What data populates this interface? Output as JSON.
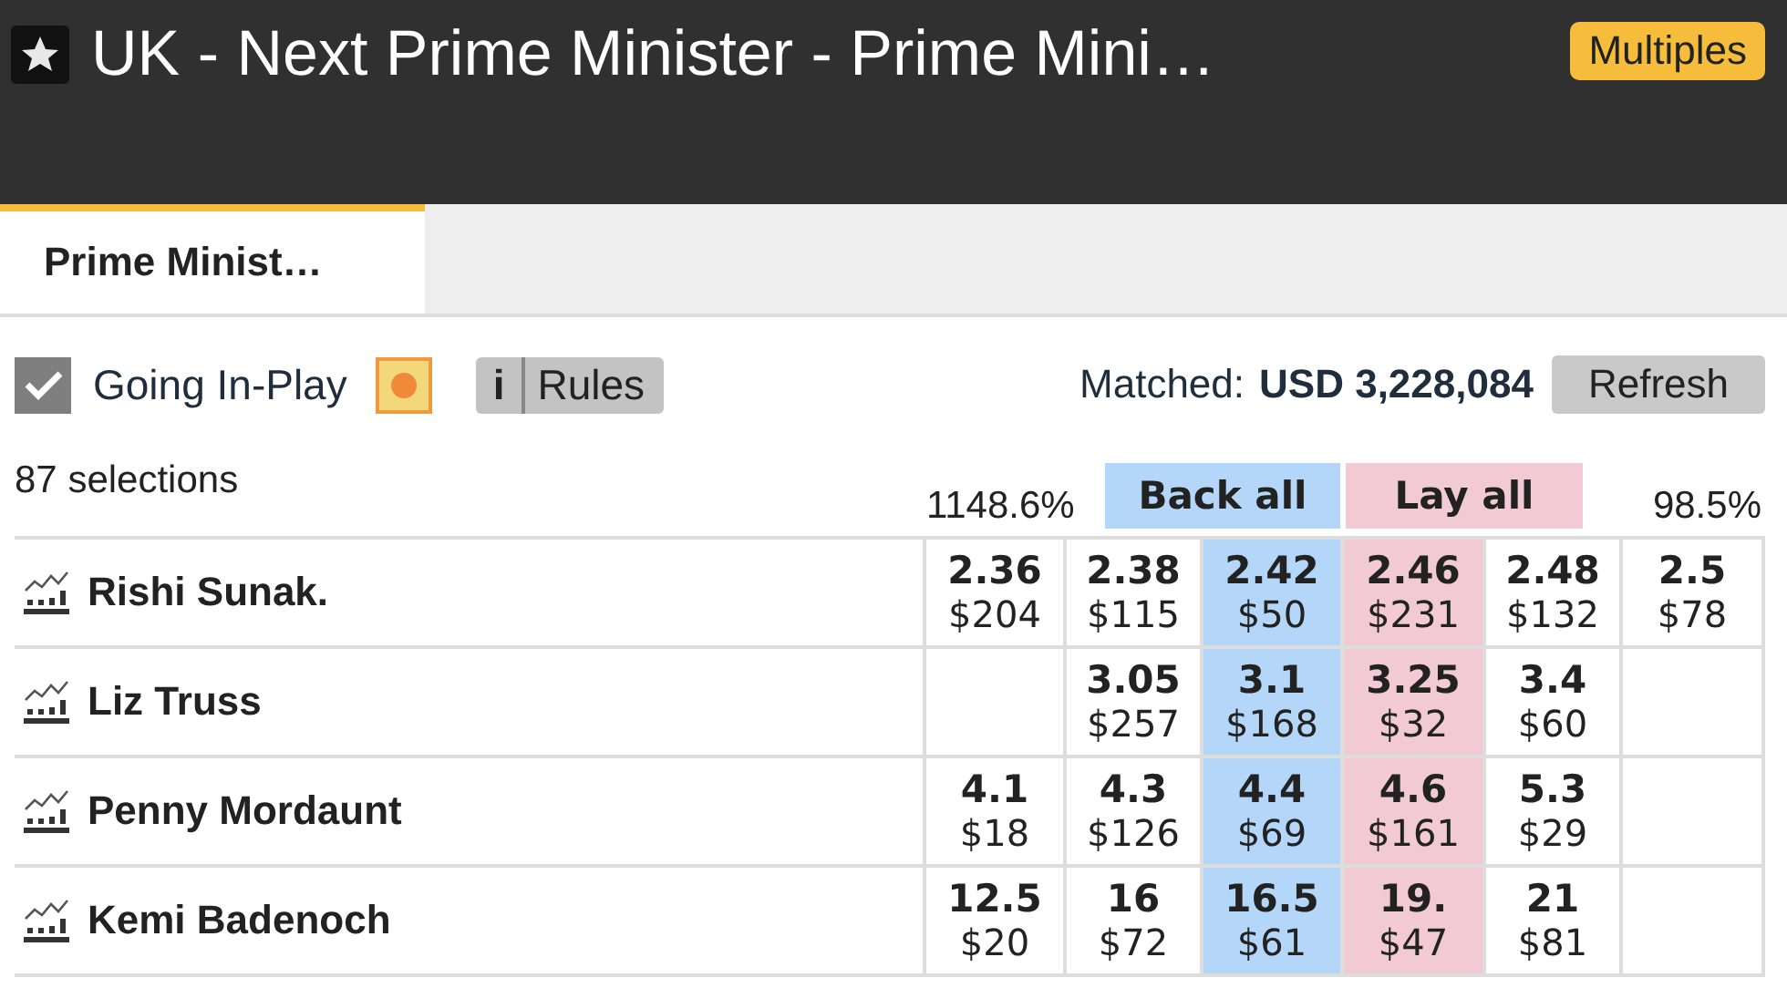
{
  "header": {
    "title": "UK - Next Prime Minister - Prime Mini…",
    "multiples_button": "Multiples"
  },
  "tabs": [
    {
      "label": "Prime Minist…",
      "selected": true
    }
  ],
  "controls": {
    "going_in_play": {
      "label": "Going In-Play",
      "checked": true
    },
    "rules_icon": "i",
    "rules_button": "Rules",
    "matched_label": "Matched:",
    "matched_value": "USD 3,228,084",
    "refresh_button": "Refresh"
  },
  "market_header": {
    "selections": "87 selections",
    "back_overround": "1148.6%",
    "back_all": "Back all",
    "lay_all": "Lay all",
    "lay_overround": "98.5%"
  },
  "runners": [
    {
      "name": "Rishi Sunak.",
      "prices": [
        {
          "kind": "back",
          "odds": "2.36",
          "amount": "$204"
        },
        {
          "kind": "back",
          "odds": "2.38",
          "amount": "$115"
        },
        {
          "kind": "best_back",
          "odds": "2.42",
          "amount": "$50"
        },
        {
          "kind": "best_lay",
          "odds": "2.46",
          "amount": "$231"
        },
        {
          "kind": "lay",
          "odds": "2.48",
          "amount": "$132"
        },
        {
          "kind": "lay",
          "odds": "2.5",
          "amount": "$78"
        }
      ]
    },
    {
      "name": "Liz Truss",
      "prices": [
        {
          "kind": "empty"
        },
        {
          "kind": "back",
          "odds": "3.05",
          "amount": "$257"
        },
        {
          "kind": "best_back",
          "odds": "3.1",
          "amount": "$168"
        },
        {
          "kind": "best_lay",
          "odds": "3.25",
          "amount": "$32"
        },
        {
          "kind": "lay",
          "odds": "3.4",
          "amount": "$60"
        },
        {
          "kind": "empty"
        }
      ]
    },
    {
      "name": "Penny Mordaunt",
      "prices": [
        {
          "kind": "back",
          "odds": "4.1",
          "amount": "$18"
        },
        {
          "kind": "back",
          "odds": "4.3",
          "amount": "$126"
        },
        {
          "kind": "best_back",
          "odds": "4.4",
          "amount": "$69"
        },
        {
          "kind": "best_lay",
          "odds": "4.6",
          "amount": "$161"
        },
        {
          "kind": "lay",
          "odds": "5.3",
          "amount": "$29"
        },
        {
          "kind": "empty"
        }
      ]
    },
    {
      "name": "Kemi Badenoch",
      "prices": [
        {
          "kind": "back",
          "odds": "12.5",
          "amount": "$20"
        },
        {
          "kind": "back",
          "odds": "16",
          "amount": "$72"
        },
        {
          "kind": "best_back",
          "odds": "16.5",
          "amount": "$61"
        },
        {
          "kind": "best_lay",
          "odds": "19.",
          "amount": "$47"
        },
        {
          "kind": "lay",
          "odds": "21",
          "amount": "$81"
        },
        {
          "kind": "empty"
        }
      ]
    }
  ]
}
